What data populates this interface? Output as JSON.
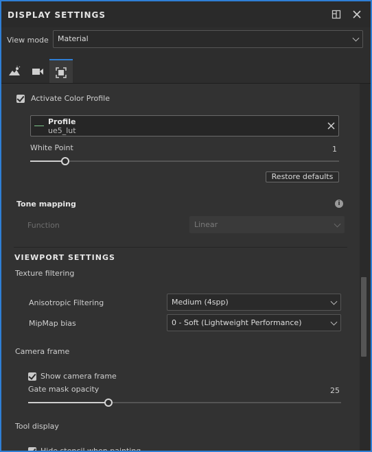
{
  "panel": {
    "title": "DISPLAY SETTINGS"
  },
  "view_mode": {
    "label": "View mode",
    "value": "Material"
  },
  "tabs": [
    {
      "icon": "landscape-icon",
      "active": false
    },
    {
      "icon": "camera-icon",
      "active": false
    },
    {
      "icon": "viewport-frame-icon",
      "active": true
    }
  ],
  "color_profile": {
    "activate_label": "Activate Color Profile",
    "activate_checked": true,
    "profile_title": "Profile",
    "profile_value": "ue5_lut",
    "white_point_label": "White Point",
    "white_point_value": "1",
    "restore_label": "Restore defaults"
  },
  "tone_mapping": {
    "title": "Tone mapping",
    "function_label": "Function",
    "function_value": "Linear"
  },
  "viewport_settings": {
    "title": "VIEWPORT SETTINGS",
    "texture_filtering_label": "Texture filtering",
    "anisotropic_label": "Anisotropic Filtering",
    "anisotropic_value": "Medium (4spp)",
    "mipmap_label": "MipMap bias",
    "mipmap_value": "0 - Soft (Lightweight Performance)",
    "camera_frame_label": "Camera frame",
    "show_camera_frame_label": "Show camera frame",
    "show_camera_frame_checked": true,
    "gate_mask_label": "Gate mask opacity",
    "gate_mask_value": "25",
    "tool_display_label": "Tool display",
    "hide_stencil_label": "Hide stencil when painting"
  },
  "colors": {
    "accent": "#2f7fd6",
    "panel_bg": "#323232"
  }
}
